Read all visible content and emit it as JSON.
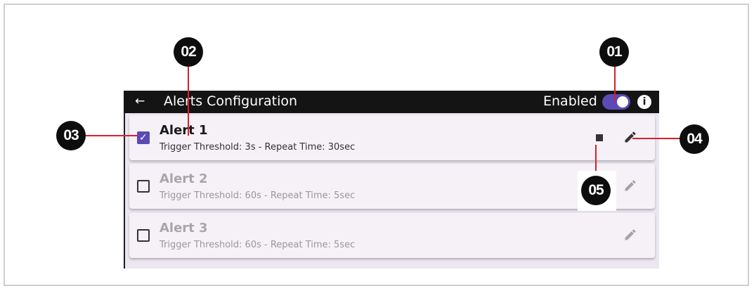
{
  "header": {
    "back_icon": "arrow-left-icon",
    "title": "Alerts Configuration",
    "enabled_label": "Enabled",
    "toggle_on": true,
    "info_icon": "i"
  },
  "alerts": [
    {
      "name": "Alert 1",
      "description": "Trigger Threshold: 3s - Repeat Time: 30sec",
      "checked": true
    },
    {
      "name": "Alert 2",
      "description": "Trigger Threshold: 60s - Repeat Time: 5sec",
      "checked": false
    },
    {
      "name": "Alert 3",
      "description": "Trigger Threshold: 60s - Repeat Time: 5sec",
      "checked": false
    }
  ],
  "callouts": [
    "01",
    "02",
    "03",
    "04",
    "05"
  ],
  "colors": {
    "accent": "#5b4bb5",
    "callout_line": "#d8202a",
    "topbar": "#141414",
    "card": "#f5f1f7"
  }
}
